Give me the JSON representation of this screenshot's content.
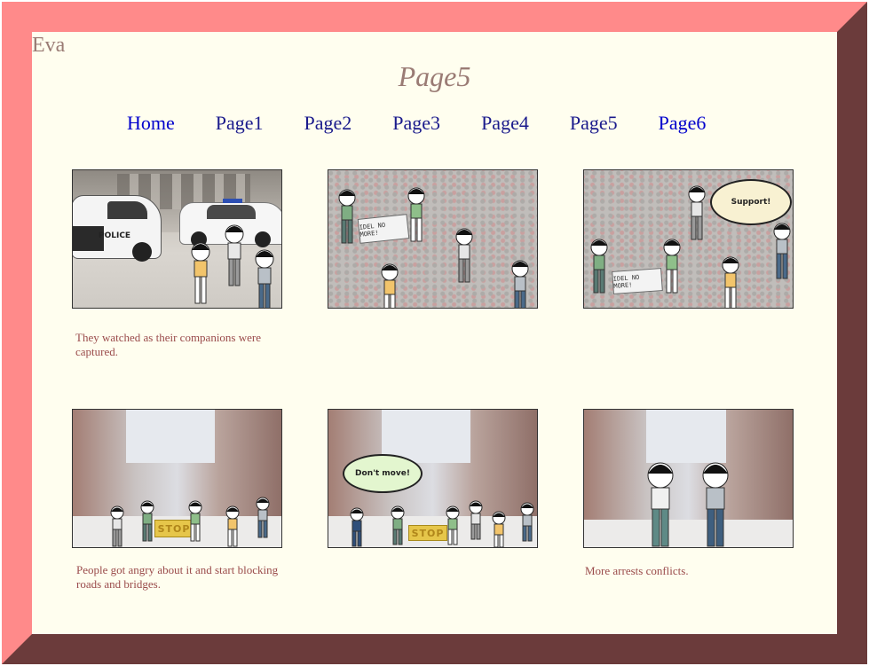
{
  "site": {
    "brand": "Eva",
    "page_title": "Page5"
  },
  "nav": [
    {
      "label": "Home"
    },
    {
      "label": "Page1"
    },
    {
      "label": "Page2"
    },
    {
      "label": "Page3"
    },
    {
      "label": "Page4"
    },
    {
      "label": "Page5"
    },
    {
      "label": "Page6"
    }
  ],
  "panels": [
    {
      "caption": "They watched as their companions were captured.",
      "police_label": "POLICE"
    },
    {
      "banner": "IDEL NO MORE!"
    },
    {
      "banner": "IDEL NO MORE!",
      "speech": "Support!"
    },
    {
      "caption": "People got angry about it and start blocking roads and bridges.",
      "stop_label": "STOP"
    },
    {
      "speech": "Don't move!",
      "stop_label": "STOP"
    },
    {
      "caption": "More arrests conflicts."
    }
  ],
  "colors": {
    "border_light": "#ff8a8a",
    "border_dark": "#6b3b3b",
    "page_bg": "#fffeef",
    "title_color": "#9a7b74",
    "caption_color": "#9a4b4b",
    "nav_link": "#0000cc",
    "nav_visited": "#1a1a8c"
  }
}
